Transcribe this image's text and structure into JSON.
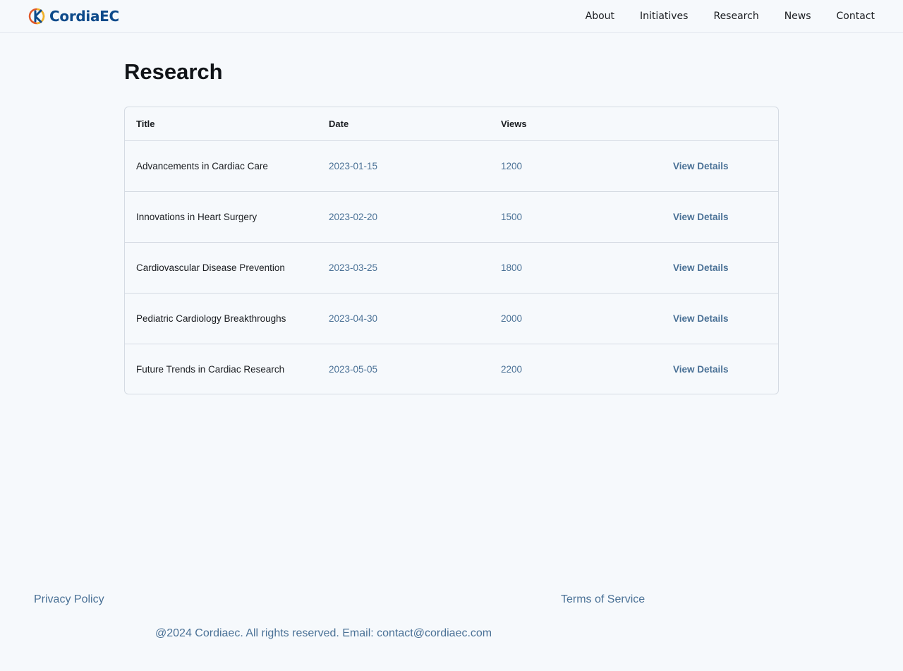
{
  "header": {
    "logo_text": "CordiaEC",
    "nav": [
      "About",
      "Initiatives",
      "Research",
      "News",
      "Contact"
    ]
  },
  "main": {
    "title": "Research",
    "table": {
      "columns": [
        "Title",
        "Date",
        "Views",
        ""
      ],
      "rows": [
        {
          "title": "Advancements in Cardiac Care",
          "date": "2023-01-15",
          "views": "1200",
          "action": "View Details"
        },
        {
          "title": "Innovations in Heart Surgery",
          "date": "2023-02-20",
          "views": "1500",
          "action": "View Details"
        },
        {
          "title": "Cardiovascular Disease Prevention",
          "date": "2023-03-25",
          "views": "1800",
          "action": "View Details"
        },
        {
          "title": "Pediatric Cardiology Breakthroughs",
          "date": "2023-04-30",
          "views": "2000",
          "action": "View Details"
        },
        {
          "title": "Future Trends in Cardiac Research",
          "date": "2023-05-05",
          "views": "2200",
          "action": "View Details"
        }
      ]
    }
  },
  "footer": {
    "privacy": "Privacy Policy",
    "terms": "Terms of Service",
    "copyright": "@2024 Cordiaec. All rights reserved. Email: contact@cordiaec.com"
  },
  "colors": {
    "background": "#f6f9fc",
    "brand": "#0d4a8a",
    "link": "#4a7196",
    "logo_accent": "#e0582a"
  },
  "icons": {
    "logo": "cordiaec-logo-icon"
  }
}
